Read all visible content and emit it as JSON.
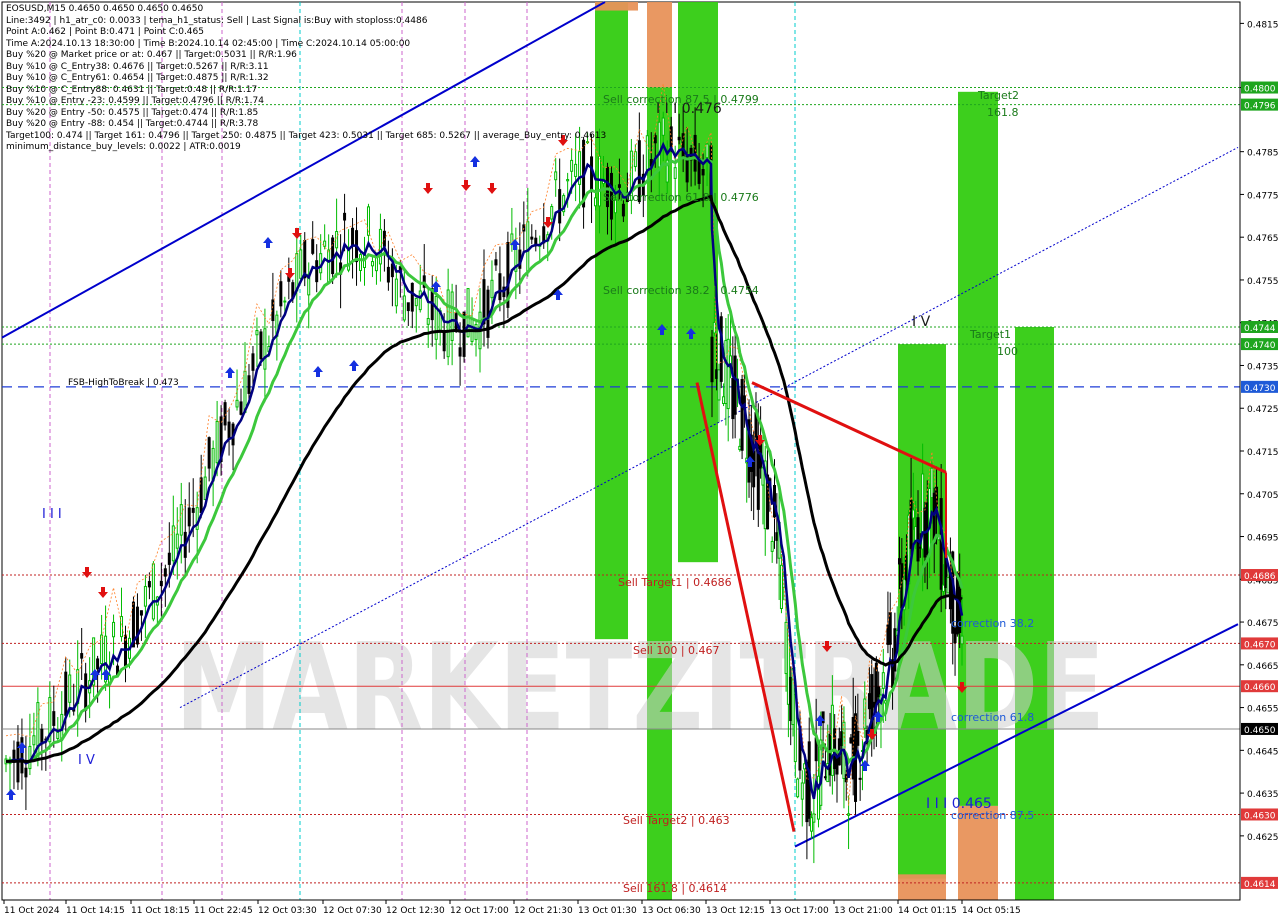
{
  "info": {
    "lines": [
      "EOSUSD,M15  0.4650 0.4650 0.4650 0.4650",
      "Line:3492 | h1_atr_c0: 0.0033 | tema_h1_status: Sell | Last Signal is:Buy with stoploss:0.4486",
      "Point A:0.462 | Point B:0.471 | Point C:0.465",
      "Time A:2024.10.13 18:30:00 | Time B:2024.10.14 02:45:00 | Time C:2024.10.14 05:00:00",
      "Buy %20 @ Market price or at: 0.467 || Target:0.5031 || R/R:1.96",
      "Buy %10 @ C_Entry38: 0.4676 || Target:0.5267 || R/R:3.11",
      "Buy %10 @ C_Entry61: 0.4654 || Target:0.4875 || R/R:1.32",
      "Buy %10 @ C_Entry88: 0.4631 || Target:0.48 || R/R:1.17",
      "Buy %10 @ Entry -23: 0.4599 || Target:0.4796 || R/R:1.74",
      "Buy %20 @ Entry -50: 0.4575 || Target:0.474 || R/R:1.85",
      "Buy %20 @ Entry -88: 0.454 || Target:0.4744 || R/R:3.78",
      "Target100: 0.474 || Target 161: 0.4796 || Target 250: 0.4875 || Target 423: 0.5031 || Target 685: 0.5267 || average_Buy_entry: 0.4613",
      "minimum_distance_buy_levels: 0.0022 | ATR:0.0019"
    ]
  },
  "watermark": "MARKETZITRADE",
  "chart_data": {
    "type": "candlestick",
    "symbol": "EOSUSD",
    "timeframe": "M15",
    "ylim": [
      0.461,
      0.482
    ],
    "y_ticks": [
      "0.4815",
      "0.4800",
      "0.4785",
      "0.4775",
      "0.4765",
      "0.4755",
      "0.4745",
      "0.4735",
      "0.4725",
      "0.4715",
      "0.4705",
      "0.4695",
      "0.4685",
      "0.4675",
      "0.4665",
      "0.4655",
      "0.4645",
      "0.4635",
      "0.4625"
    ],
    "x_ticks": [
      "11 Oct 2024",
      "11 Oct 14:15",
      "11 Oct 18:15",
      "11 Oct 22:45",
      "12 Oct 03:30",
      "12 Oct 07:30",
      "12 Oct 12:30",
      "12 Oct 17:00",
      "12 Oct 21:30",
      "13 Oct 01:30",
      "13 Oct 06:30",
      "13 Oct 12:15",
      "13 Oct 17:00",
      "13 Oct 21:00",
      "14 Oct 01:15",
      "14 Oct 05:15"
    ],
    "price_tags": [
      {
        "value": 0.48,
        "label": "0.4800",
        "color": "#1ea51e"
      },
      {
        "value": 0.4796,
        "label": "0.4796",
        "color": "#1ea51e"
      },
      {
        "value": 0.4744,
        "label": "0.4744",
        "color": "#1ea51e"
      },
      {
        "value": 0.474,
        "label": "0.4740",
        "color": "#1ea51e"
      },
      {
        "value": 0.473,
        "label": "0.4730",
        "color": "#1e5ad7"
      },
      {
        "value": 0.4686,
        "label": "0.4686",
        "color": "#e03a3a"
      },
      {
        "value": 0.467,
        "label": "0.4670",
        "color": "#e03a3a"
      },
      {
        "value": 0.466,
        "label": "0.4660",
        "color": "#e03a3a"
      },
      {
        "value": 0.465,
        "label": "0.4650",
        "color": "#000000"
      },
      {
        "value": 0.463,
        "label": "0.4630",
        "color": "#e03a3a"
      },
      {
        "value": 0.4614,
        "label": "0.4614",
        "color": "#e03a3a"
      }
    ],
    "levels": [
      {
        "label": "Sell correction 87.5 | 0.4799",
        "value": 0.4799,
        "color": "#1a7a1a"
      },
      {
        "label": "Sell correction 61.8 | 0.4776",
        "value": 0.4776,
        "color": "#1a7a1a"
      },
      {
        "label": "Sell correction 38.2 | 0.4754",
        "value": 0.4754,
        "color": "#1a7a1a"
      },
      {
        "label": "FSB-HighToBreak | 0.473",
        "value": 0.473,
        "color": "#000000"
      },
      {
        "label": "Sell Target1 | 0.4686",
        "value": 0.4686,
        "color": "#c02020"
      },
      {
        "label": "Sell 100 | 0.467",
        "value": 0.467,
        "color": "#c02020"
      },
      {
        "label": "Sell Target2 | 0.463",
        "value": 0.463,
        "color": "#c02020"
      },
      {
        "label": "Sell 161.8 | 0.4614",
        "value": 0.4614,
        "color": "#c02020"
      },
      {
        "label": "Target2",
        "value": 0.4798,
        "color": "#1a7a1a"
      },
      {
        "label": "161.8",
        "value": 0.4795,
        "color": "#1a7a1a"
      },
      {
        "label": "Target1",
        "value": 0.4741,
        "color": "#1a7a1a"
      },
      {
        "label": "100",
        "value": 0.4737,
        "color": "#1a7a1a"
      },
      {
        "label": "correction 38.2",
        "value": 0.4672,
        "color": "#1e5ad7"
      },
      {
        "label": "correction 61.8",
        "value": 0.4652,
        "color": "#1e5ad7"
      },
      {
        "label": "correction 87.5",
        "value": 0.463,
        "color": "#1e5ad7"
      }
    ],
    "wave_labels": [
      "I I I",
      "I V",
      "I I I 0.476",
      "I V",
      "I I I 0.465"
    ],
    "colors": {
      "up": "#00bb00",
      "down": "#000000",
      "ema_dark": "#000080",
      "ema_green": "#3cc83c",
      "sma": "#000000",
      "channel": "#0000cc",
      "zone_green": "#33cc11",
      "zone_orange": "#e8925a"
    }
  }
}
